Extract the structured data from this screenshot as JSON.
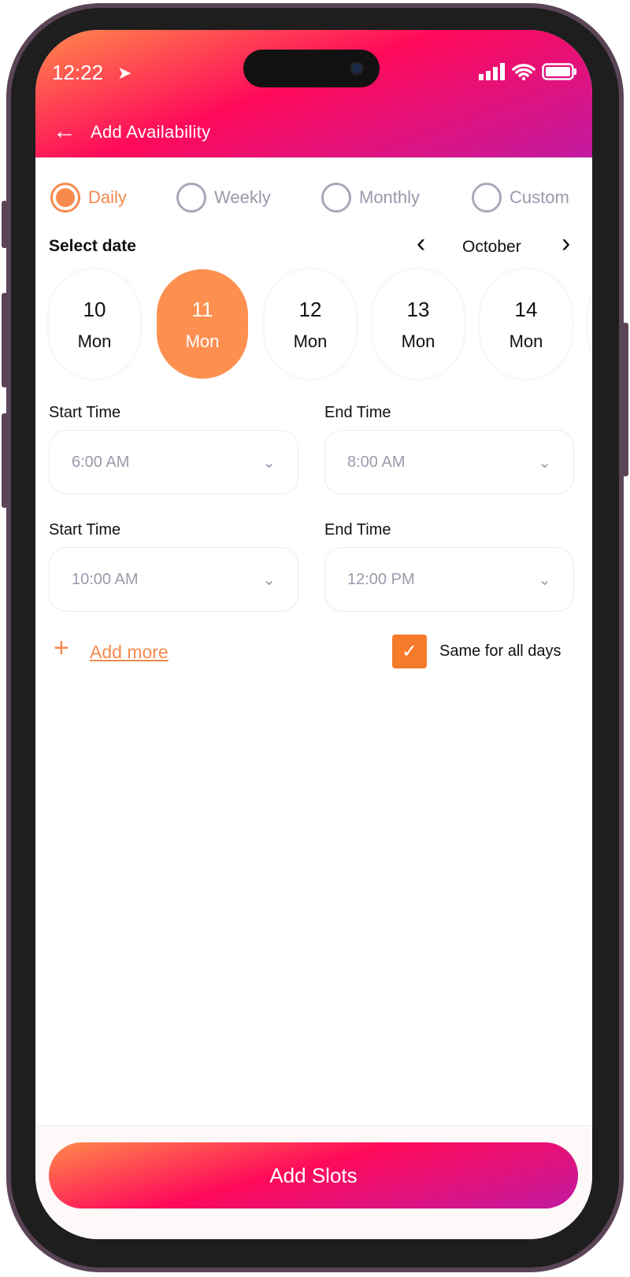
{
  "status_bar": {
    "time": "12:22"
  },
  "header": {
    "title": "Add Availability"
  },
  "frequency": {
    "options": [
      "Daily",
      "Weekly",
      "Monthly",
      "Custom"
    ],
    "selected": "Daily"
  },
  "date_picker": {
    "label": "Select date",
    "month": "October",
    "days": [
      {
        "date": "10",
        "weekday": "Mon"
      },
      {
        "date": "11",
        "weekday": "Mon"
      },
      {
        "date": "12",
        "weekday": "Mon"
      },
      {
        "date": "13",
        "weekday": "Mon"
      },
      {
        "date": "14",
        "weekday": "Mon"
      }
    ],
    "selected": "11"
  },
  "slots": [
    {
      "start_label": "Start Time",
      "start": "6:00 AM",
      "end_label": "End Time",
      "end": "8:00 AM"
    },
    {
      "start_label": "Start Time",
      "start": "10:00 AM",
      "end_label": "End Time",
      "end": "12:00 PM"
    }
  ],
  "add_more": "Add more",
  "same_for_all": {
    "label": "Same for all days",
    "checked": true
  },
  "cta": "Add Slots",
  "colors": {
    "accent": "#f88a4d",
    "gradient_start": "#ff8a4a",
    "gradient_mid": "#ff0a5a",
    "gradient_end": "#c11aa0"
  }
}
